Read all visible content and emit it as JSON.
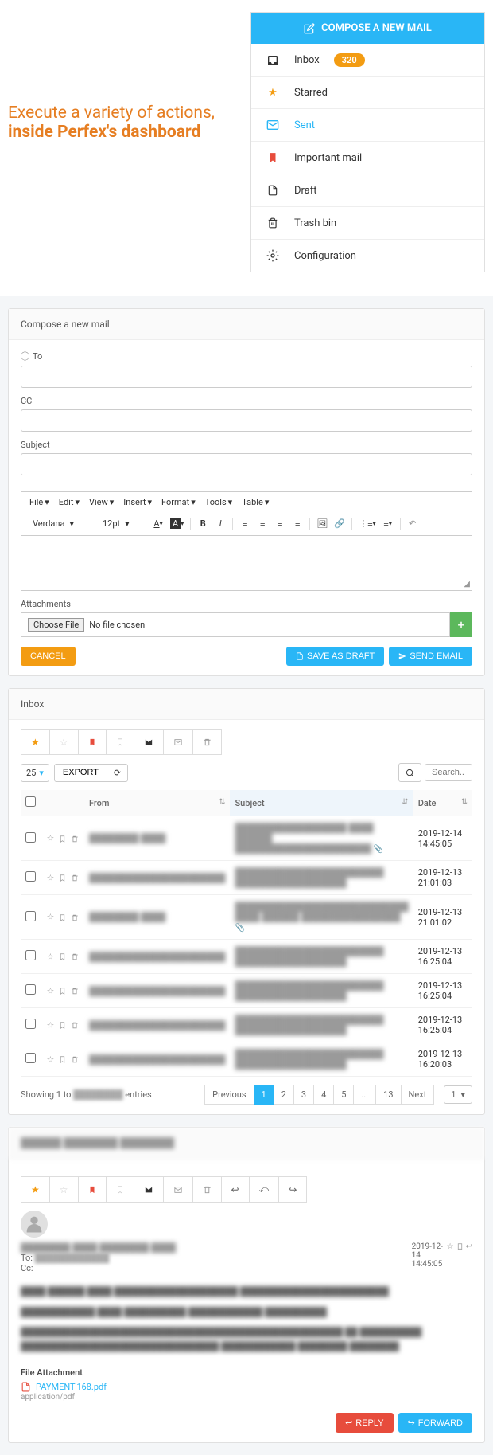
{
  "heading": {
    "line1": "Execute a variety of actions,",
    "line2": "inside Perfex's dashboard"
  },
  "compose_button": "COMPOSE A NEW MAIL",
  "nav": {
    "inbox": "Inbox",
    "inbox_badge": "320",
    "starred": "Starred",
    "sent": "Sent",
    "important": "Important mail",
    "draft": "Draft",
    "trash": "Trash bin",
    "config": "Configuration"
  },
  "compose_panel": {
    "title": "Compose a new mail",
    "to": "To",
    "cc": "CC",
    "subject": "Subject",
    "editor_menus": [
      "File",
      "Edit",
      "View",
      "Insert",
      "Format",
      "Tools",
      "Table"
    ],
    "font": "Verdana",
    "size": "12pt",
    "attachments": "Attachments",
    "choose_file": "Choose File",
    "no_file": "No file chosen",
    "cancel": "CANCEL",
    "save_draft": "SAVE AS DRAFT",
    "send": "SEND EMAIL"
  },
  "inbox_panel": {
    "title": "Inbox",
    "page_size": "25",
    "export": "EXPORT",
    "search_placeholder": "Search...",
    "columns": {
      "from": "From",
      "subject": "Subject",
      "date": "Date"
    },
    "rows": [
      {
        "from": "████████ ████",
        "subject": "██████████████████ ████ ██████ ██████████████████████",
        "date": "2019-12-14 14:45:05",
        "clip": true
      },
      {
        "from": "██████████████████████",
        "subject": "████████████████████████ ██████████████████",
        "date": "2019-12-13 21:01:03",
        "clip": false
      },
      {
        "from": "████████ ████",
        "subject": "████████████████████████████ ████ ██████ ████████████████",
        "date": "2019-12-13 21:01:02",
        "clip": true
      },
      {
        "from": "██████████████████████",
        "subject": "████████████████████████ ██████████████████",
        "date": "2019-12-13 16:25:04",
        "clip": false
      },
      {
        "from": "██████████████████████",
        "subject": "████████████████████████ ██████████████████",
        "date": "2019-12-13 16:25:04",
        "clip": false
      },
      {
        "from": "██████████████████████",
        "subject": "████████████████████████ ██████████████████",
        "date": "2019-12-13 16:25:04",
        "clip": false
      },
      {
        "from": "██████████████████████",
        "subject": "████████████████████████ ██████████████████",
        "date": "2019-12-13 16:20:03",
        "clip": false
      }
    ],
    "showing_prefix": "Showing 1 to ",
    "showing_mid": "████████",
    "showing_suffix": " entries",
    "prev": "Previous",
    "next": "Next",
    "pages": [
      "1",
      "2",
      "3",
      "4",
      "5",
      "...",
      "13"
    ],
    "page_select": "1"
  },
  "message": {
    "title": "██████ ████████ ████████",
    "from_name": "████████ ████ ████████ ████",
    "to_label": "To:",
    "to_value": "████████████",
    "cc_label": "Cc:",
    "date": "2019-12-14 14:45:05",
    "body_blocks": [
      "████ ██████ ████\n████████████████████ ████████████████████████",
      "████████████\n████ ██████████\n████████████ ██████████",
      "████████████████████████████████████████████████████\n██ ██████████\n████████████████████████████████\n████████████\n████████\n████████"
    ],
    "attachment_label": "File Attachment",
    "attachment_file": "PAYMENT-168.pdf",
    "attachment_type": "application/pdf",
    "reply": "REPLY",
    "forward": "FORWARD"
  }
}
